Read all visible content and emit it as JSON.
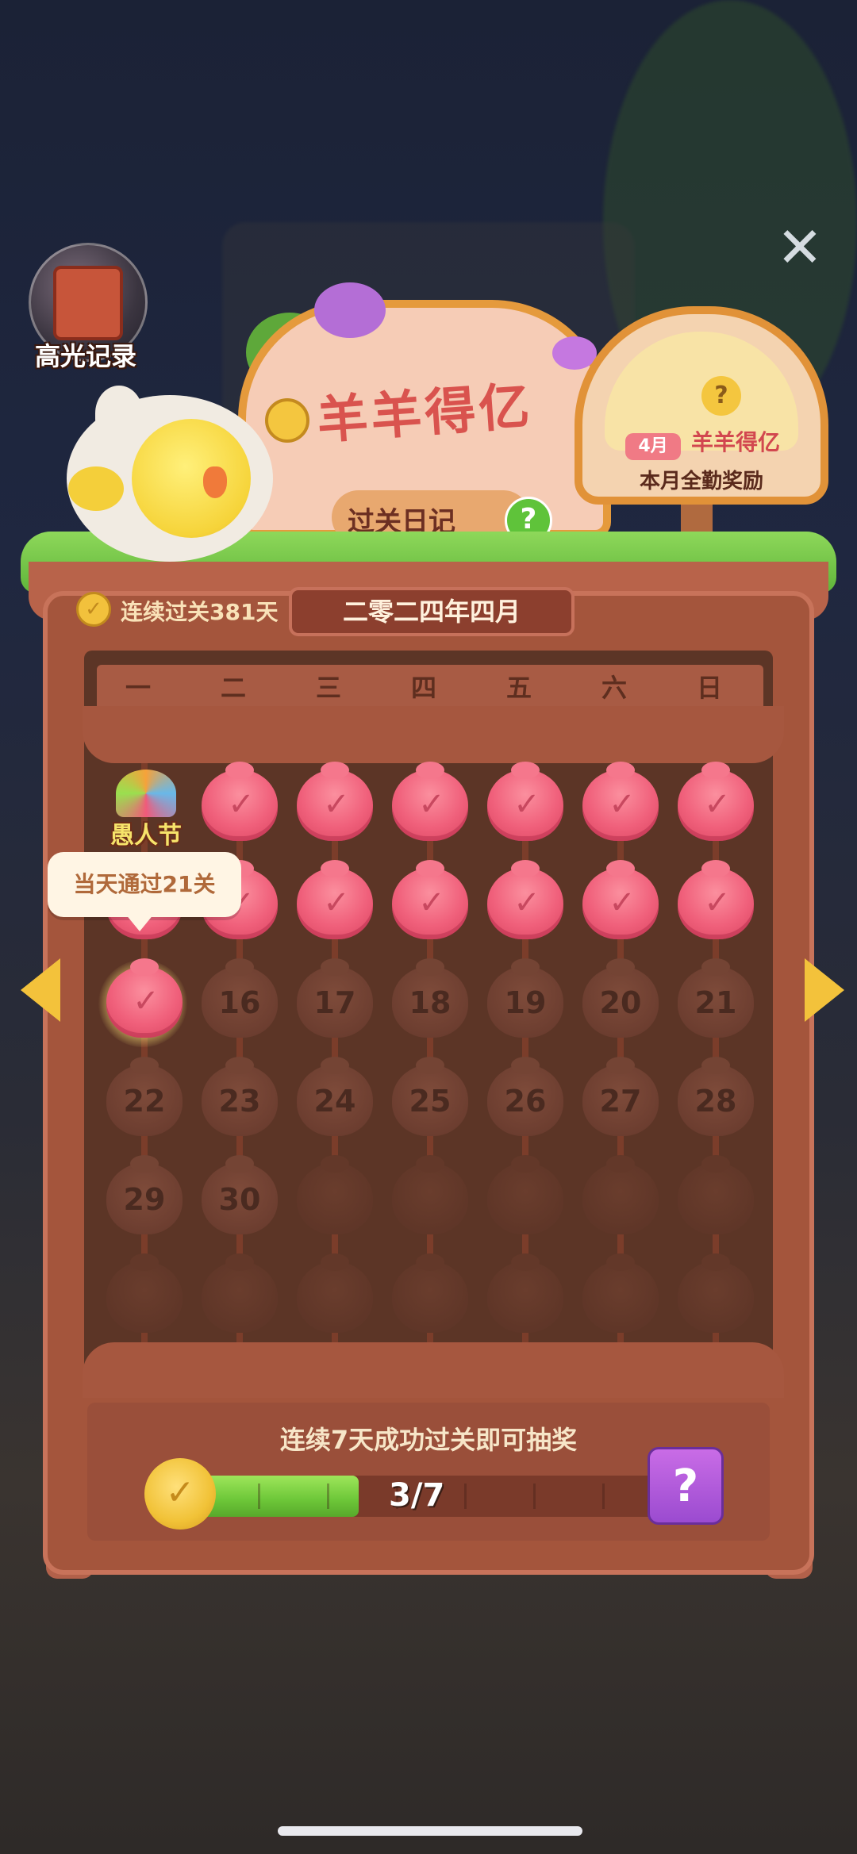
{
  "header": {
    "close_icon": "close-icon",
    "highlight_label": "高光记录"
  },
  "sign": {
    "title": "羊羊得亿",
    "subtitle": "过关日记",
    "help_glyph": "?"
  },
  "award": {
    "month_tag": "4月",
    "logo_text": "羊羊得亿",
    "caption": "本月全勤奖励",
    "mystery_glyph": "?"
  },
  "streak": {
    "text": "连续过关381天",
    "coin_glyph": "✓"
  },
  "calendar": {
    "month_title": "二零二四年四月",
    "weekdays": [
      "一",
      "二",
      "三",
      "四",
      "五",
      "六",
      "日"
    ],
    "festival_label": "愚人节",
    "tooltip": "当天通过21关",
    "rows": [
      [
        {
          "state": "festival"
        },
        {
          "state": "done"
        },
        {
          "state": "done"
        },
        {
          "state": "done"
        },
        {
          "state": "done"
        },
        {
          "state": "done"
        },
        {
          "state": "done"
        }
      ],
      [
        {
          "state": "done"
        },
        {
          "state": "done"
        },
        {
          "state": "done"
        },
        {
          "state": "done"
        },
        {
          "state": "done"
        },
        {
          "state": "done"
        },
        {
          "state": "done"
        }
      ],
      [
        {
          "state": "today"
        },
        {
          "state": "future",
          "day": "16"
        },
        {
          "state": "future",
          "day": "17"
        },
        {
          "state": "future",
          "day": "18"
        },
        {
          "state": "future",
          "day": "19"
        },
        {
          "state": "future",
          "day": "20"
        },
        {
          "state": "future",
          "day": "21"
        }
      ],
      [
        {
          "state": "future",
          "day": "22"
        },
        {
          "state": "future",
          "day": "23"
        },
        {
          "state": "future",
          "day": "24"
        },
        {
          "state": "future",
          "day": "25"
        },
        {
          "state": "future",
          "day": "26"
        },
        {
          "state": "future",
          "day": "27"
        },
        {
          "state": "future",
          "day": "28"
        }
      ],
      [
        {
          "state": "future",
          "day": "29"
        },
        {
          "state": "future",
          "day": "30"
        },
        {
          "state": "empty"
        },
        {
          "state": "empty"
        },
        {
          "state": "empty"
        },
        {
          "state": "empty"
        },
        {
          "state": "empty"
        }
      ],
      [
        {
          "state": "empty"
        },
        {
          "state": "empty"
        },
        {
          "state": "empty"
        },
        {
          "state": "empty"
        },
        {
          "state": "empty"
        },
        {
          "state": "empty"
        },
        {
          "state": "empty"
        }
      ]
    ]
  },
  "progress": {
    "prompt": "连续7天成功过关即可抽奖",
    "current": 3,
    "total": 7,
    "label": "3/7",
    "gift_glyph": "?"
  },
  "colors": {
    "accent_green": "#6cc638",
    "peach_pink": "#f0607b",
    "frame_brown": "#a4553c"
  }
}
